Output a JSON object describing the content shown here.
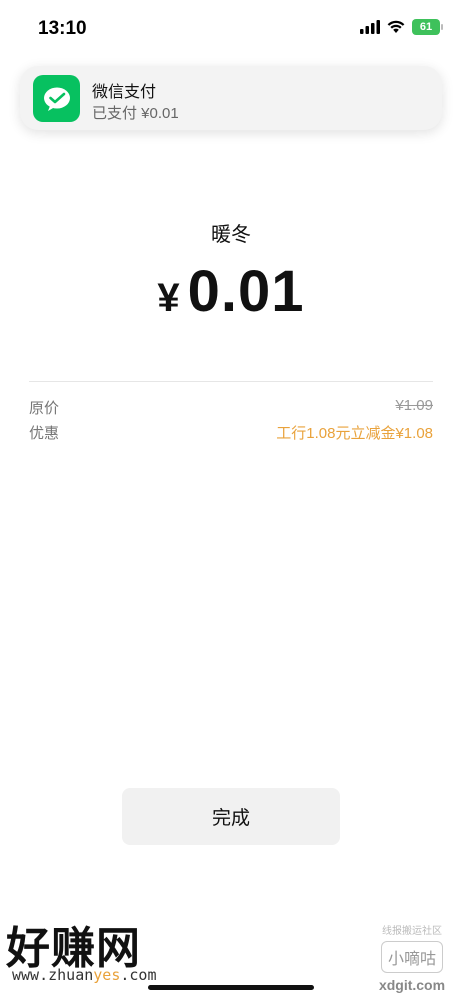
{
  "status_bar": {
    "time": "13:10",
    "battery": "61",
    "icons": [
      "cellular-signal-icon",
      "wifi-icon",
      "battery-icon"
    ]
  },
  "notification": {
    "app": "微信支付",
    "message": "已支付 ¥0.01",
    "icon": "wechat-pay-icon",
    "accent": "#07c160"
  },
  "payment": {
    "merchant": "暖冬",
    "currency": "¥",
    "amount": "0.01"
  },
  "details": [
    {
      "label": "原价",
      "value": "¥1.09",
      "style": "strike"
    },
    {
      "label": "优惠",
      "value": "工行1.08元立减金¥1.08",
      "style": "discount",
      "color": "#e9a23b"
    }
  ],
  "actions": {
    "done_label": "完成"
  },
  "watermarks": {
    "left_title": "好赚网",
    "left_url_a": "www.zhuan",
    "left_url_b": "yes",
    "left_url_c": ".com",
    "right_top": "线报搬运社区",
    "right_box": "小嘀咕",
    "right_url": "xdgit.com"
  }
}
